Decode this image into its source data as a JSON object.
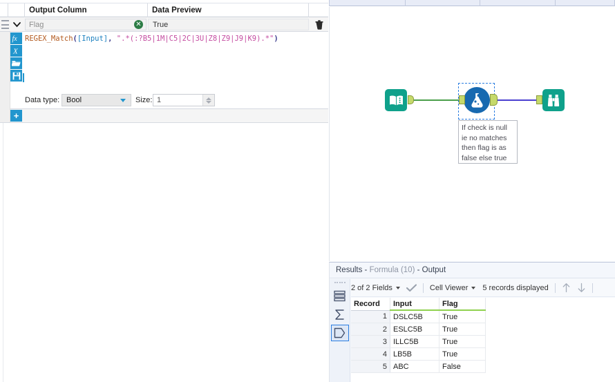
{
  "config_panel": {
    "headers": {
      "output_column": "Output Column",
      "data_preview": "Data Preview"
    },
    "field_row": {
      "output_column_value": "Flag",
      "data_preview_value": "True",
      "clear_icon": "clear-circle-icon",
      "delete_icon": "trash-icon",
      "expand_icon": "chevron-down-icon",
      "drag_icon": "drag-handle-icon"
    },
    "expression": {
      "function_name": "REGEX_Match",
      "open_paren": "(",
      "field_token": "[Input]",
      "comma": ", ",
      "string_literal": "\".*(:?B5|1M|C5|2C|3U|Z8|Z9|J9|K9).*\"",
      "close_paren": ")",
      "full_text": "REGEX_Match([Input], \".*(:?B5|1M|C5|2C|3U|Z8|Z9|J9|K9).*\")"
    },
    "rail_icons": [
      {
        "name": "fx-function-icon",
        "glyph": "fx"
      },
      {
        "name": "variable-x-icon",
        "glyph": "X"
      },
      {
        "name": "open-folder-icon",
        "glyph": "folder"
      },
      {
        "name": "save-icon",
        "glyph": "save"
      }
    ],
    "data_type": {
      "label": "Data type:",
      "value": "Bool",
      "size_label": "Size:",
      "size_value": "1"
    },
    "add_field_button": "+"
  },
  "canvas": {
    "nodes": [
      {
        "name": "text-input-tool",
        "icon": "book-icon",
        "type": "square",
        "color": "#0fa18b"
      },
      {
        "name": "formula-tool",
        "icon": "flask-icon",
        "type": "circle",
        "color": "#1769b0",
        "selected": true
      },
      {
        "name": "browse-tool",
        "icon": "binoculars-icon",
        "type": "square",
        "color": "#0fa18b"
      }
    ],
    "wires": [
      {
        "name": "wire-input-to-formula",
        "color": "#4a9e4a"
      },
      {
        "name": "wire-formula-to-browse",
        "color": "#4a3fd0"
      }
    ],
    "annotation": "If check is null ie no matches then flag is as false else true"
  },
  "results": {
    "title_prefix": "Results - ",
    "title_tool": "Formula (10)",
    "title_suffix": " - Output",
    "title_full": "Results - Formula (10) - Output",
    "toolbar": {
      "fields_selector": "2 of 2 Fields",
      "check_icon": "checkmark-icon",
      "cell_viewer": "Cell Viewer",
      "records_displayed": "5 records displayed",
      "up_icon": "arrow-up-icon",
      "down_icon": "arrow-down-icon"
    },
    "rail_icons": [
      {
        "name": "data-rows-icon",
        "glyph": "rows"
      },
      {
        "name": "sigma-profile-icon",
        "glyph": "sigma"
      },
      {
        "name": "tag-metadata-icon",
        "glyph": "tag",
        "active": true
      }
    ],
    "table": {
      "columns": [
        "Record",
        "Input",
        "Flag"
      ],
      "rows": [
        {
          "record": "1",
          "input": "DSLC5B",
          "flag": "True"
        },
        {
          "record": "2",
          "input": "ESLC5B",
          "flag": "True"
        },
        {
          "record": "3",
          "input": "ILLC5B",
          "flag": "True"
        },
        {
          "record": "4",
          "input": "LB5B",
          "flag": "True"
        },
        {
          "record": "5",
          "input": "ABC",
          "flag": "False"
        }
      ]
    }
  },
  "colors": {
    "accent_blue": "#2296ce",
    "teal_node": "#0fa18b",
    "formula_blue": "#1769b0",
    "green_wire": "#4a9e4a",
    "purple_wire": "#4a3fd0",
    "header_underline": "#8fd14f",
    "port_green": "#c5d96b"
  }
}
